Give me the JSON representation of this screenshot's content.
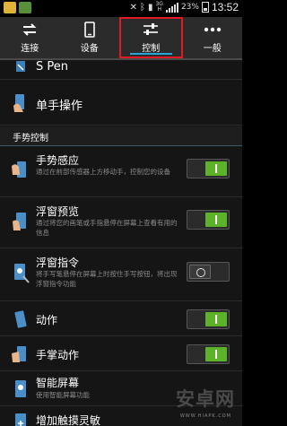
{
  "status_bar": {
    "time": "13:52",
    "battery_percent": "23%",
    "network": "3G",
    "network_sub": "H"
  },
  "tabs": [
    {
      "label": "连接",
      "icon": "connect-icon"
    },
    {
      "label": "设备",
      "icon": "device-icon"
    },
    {
      "label": "控制",
      "icon": "sliders-icon",
      "active": true
    },
    {
      "label": "一般",
      "icon": "more-icon"
    }
  ],
  "items": {
    "spen": {
      "title": "S Pen"
    },
    "one_hand": {
      "title": "单手操作"
    },
    "gesture_section": {
      "label": "手势控制"
    },
    "air_gesture": {
      "title": "手势感应",
      "subtitle": "通过在前部传感器上方移动手，控制您的设备",
      "enabled": true
    },
    "air_view": {
      "title": "浮窗预览",
      "subtitle": "通过将您的画笔或手指悬停在屏幕上查看有用的信息",
      "enabled": true
    },
    "floating_cmd": {
      "title": "浮窗指令",
      "subtitle": "将手写笔悬停在屏幕上时按住手写按钮，将出现浮窗指令功能",
      "enabled": false
    },
    "motion": {
      "title": "动作",
      "enabled": true
    },
    "palm_motion": {
      "title": "手掌动作",
      "enabled": true
    },
    "smart_screen": {
      "title": "智能屏幕",
      "subtitle": "使用智能屏幕功能"
    },
    "touch_sensitivity": {
      "title": "增加触摸灵敏"
    }
  },
  "watermark": {
    "text": "安卓网",
    "url": "WWW.HIAPK.COM"
  },
  "colors": {
    "accent_green": "#5cb32a",
    "highlight_red": "#e01b24",
    "tab_underline": "#2aa4d6"
  }
}
